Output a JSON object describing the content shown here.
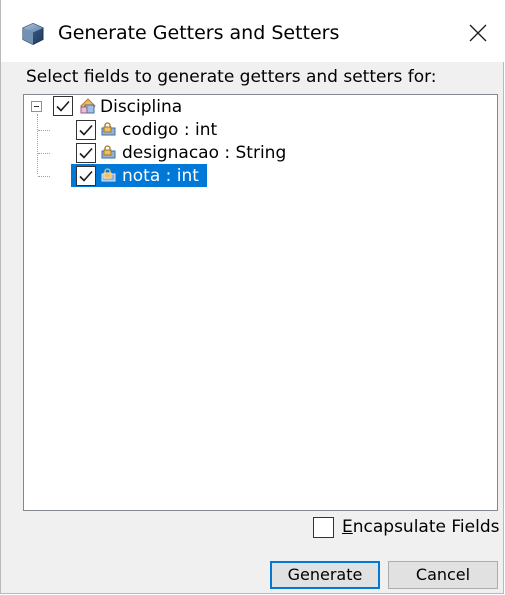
{
  "window": {
    "title": "Generate Getters and Setters",
    "icon": "cube-icon",
    "close_icon": "close-icon"
  },
  "prompt": "Select fields to generate getters and setters for:",
  "tree": {
    "root": {
      "label": "Disciplina",
      "checked": true,
      "expanded": true,
      "icon": "class-icon"
    },
    "fields": [
      {
        "label": "codigo : int",
        "checked": true,
        "selected": false,
        "icon": "field-icon"
      },
      {
        "label": "designacao : String",
        "checked": true,
        "selected": false,
        "icon": "field-icon"
      },
      {
        "label": "nota : int",
        "checked": true,
        "selected": true,
        "icon": "field-icon"
      }
    ]
  },
  "encapsulate": {
    "label_mnemonic": "E",
    "label_rest": "ncapsulate Fields",
    "checked": false
  },
  "buttons": {
    "generate": "Generate",
    "cancel": "Cancel"
  },
  "colors": {
    "selection": "#0078d7",
    "dialog_bg": "#f0f0f0",
    "default_button_border": "#0078d7"
  }
}
